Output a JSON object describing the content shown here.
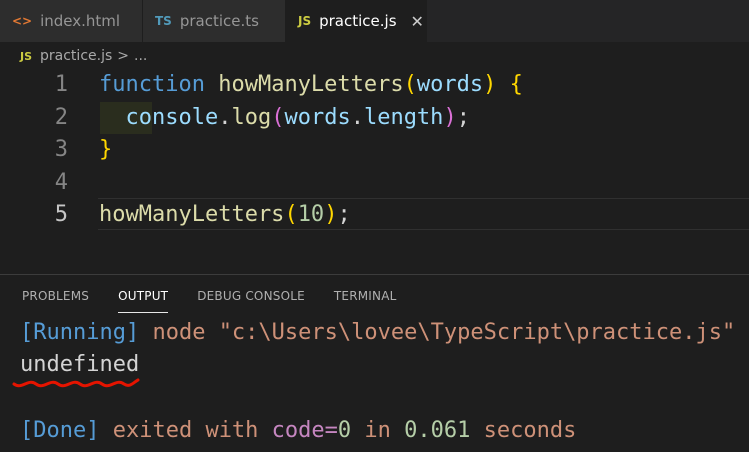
{
  "tabs": [
    {
      "icon": "<>",
      "label": "index.html"
    },
    {
      "icon": "TS",
      "label": "practice.ts"
    },
    {
      "icon": "JS",
      "label": "practice.js",
      "close": "✕"
    }
  ],
  "breadcrumb": {
    "icon": "JS",
    "file": "practice.js",
    "sep": ">",
    "rest": "..."
  },
  "editor": {
    "line_numbers": [
      "1",
      "2",
      "3",
      "4",
      "5"
    ],
    "line1": {
      "kw": "function",
      "fn": "howManyLetters",
      "open": "(",
      "param": "words",
      "close": ")",
      "brace": "{"
    },
    "line2": {
      "obj": "console",
      "dot1": ".",
      "method": "log",
      "open": "(",
      "var": "words",
      "dot2": ".",
      "prop": "length",
      "close": ")",
      "semi": ";"
    },
    "line3": {
      "brace": "}"
    },
    "line5": {
      "fn": "howManyLetters",
      "open": "(",
      "num": "10",
      "close": ")",
      "semi": ";"
    }
  },
  "panel": {
    "tabs": [
      "PROBLEMS",
      "OUTPUT",
      "DEBUG CONSOLE",
      "TERMINAL"
    ],
    "active_tab": "OUTPUT"
  },
  "output": {
    "line1": {
      "tag": "[Running]",
      "cmd": " node \"c:\\Users\\lovee\\TypeScript\\practice.js\""
    },
    "line2": "undefined",
    "line4": {
      "tag": "[Done]",
      "t1": " exited with ",
      "kw": "code=",
      "code": "0",
      "t2": " in ",
      "time": "0.061",
      "t3": " seconds"
    }
  },
  "colors": {
    "background": "#1e1e1e",
    "annotation": "#e51400"
  }
}
